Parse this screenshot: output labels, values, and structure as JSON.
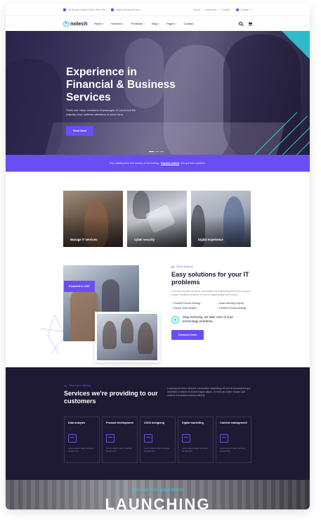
{
  "topbar": {
    "address": "66 Broklyn Golden Street. New York",
    "email": "support@example.com",
    "links": [
      "About",
      "Leadership",
      "Contact"
    ],
    "language": "English"
  },
  "nav": {
    "logo": "notech",
    "menu": [
      {
        "label": "Home",
        "active": true
      },
      {
        "label": "Services",
        "active": false
      },
      {
        "label": "Portfolios",
        "active": false
      },
      {
        "label": "Blog",
        "active": false
      },
      {
        "label": "Pages",
        "active": false
      },
      {
        "label": "Contact",
        "active": false
      }
    ]
  },
  "hero": {
    "title": "Experience in Financial & Business Services",
    "text": "There are many variations of passages of Lorem but the majority have suffered alteration in some form.",
    "button": "Read More"
  },
  "banner": {
    "text": "Stop wasting time and money on technology.",
    "link": "Explore notech",
    "tail": "and get best solutions."
  },
  "cards": [
    {
      "label": "Manage IT services"
    },
    {
      "label": "Cyber security"
    },
    {
      "label": "Digital experience"
    }
  ],
  "about": {
    "badge": "Founded in 1987",
    "kicker": "Get to know us",
    "title": "Easy solutions for your IT problems",
    "para": "Lorem ipsum dolor sit amet, consectetur not adipisicing elit sed do eiusmod tempor incididunt ut labore et dolore magna aliqua enim minim.",
    "checks": [
      "Powerful Product Strategy",
      "Award Winning Projects",
      "Experts Team Member",
      "Powerful Product Strategy"
    ],
    "worry": "Stop worrying, we take care of your technology problems.",
    "button": "Discover more"
  },
  "services": {
    "kicker": "What we're offering",
    "title": "Services we're providing to our customers",
    "para": "Lorem ipsum dolor sit amet, consectetur adipisicing elit sed do eiusmod tempor incididunt ut labore et dolore magna aliqua. Ut enim ad minim veniam quis nostrud exercitation ullamco laboris.",
    "items": [
      {
        "title": "Data analysis",
        "desc": "Lorem ipsum dolor sit amet, sit amet do."
      },
      {
        "title": "Product development",
        "desc": "Lorem ipsum dolor sit amet, sit amet do."
      },
      {
        "title": "UI/UX designing",
        "desc": "Lorem ipsum dolor sit amet, sit amet do."
      },
      {
        "title": "Digital marketing",
        "desc": "Lorem ipsum dolor sit amet, sit amet do."
      },
      {
        "title": "Content management",
        "desc": "Lorem ipsum dolor sit amet, sit amet do."
      }
    ]
  },
  "launch": {
    "subtitle": "Business from great idea to",
    "title": "LAUNCHING"
  },
  "colors": {
    "accent": "#6a4df5",
    "teal": "#2fd4e0",
    "dark": "#1e1a33"
  }
}
